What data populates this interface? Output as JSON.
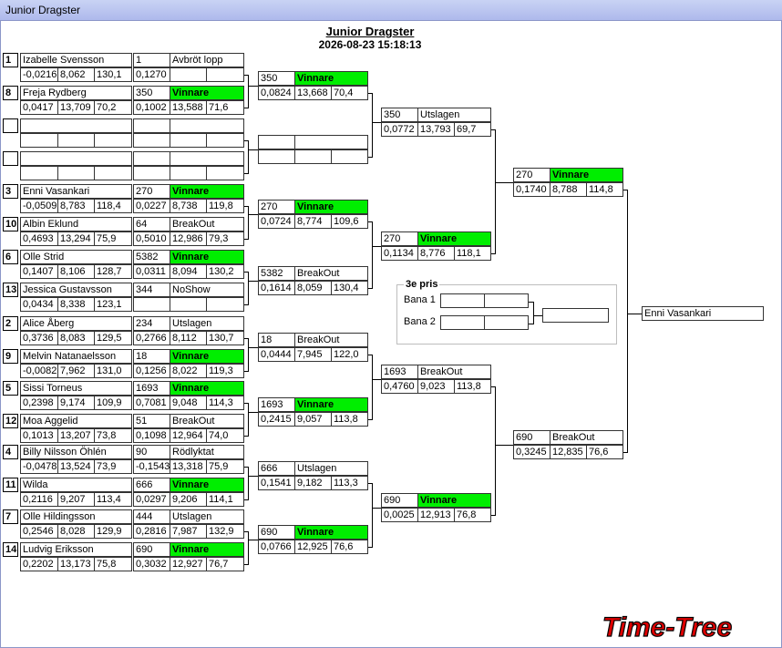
{
  "window": {
    "title": "Junior Dragster"
  },
  "header": {
    "title": "Junior Dragster",
    "datetime": "2026-08-23 15:18:13"
  },
  "colors": {
    "winner": "#00ee00",
    "logo": "#e00000"
  },
  "logo": {
    "text": "Time-Tree"
  },
  "round1": [
    {
      "seed": "1",
      "name": "Izabelle Svensson",
      "rt": "-0,0216",
      "et": "8,062",
      "mph": "130,1",
      "dial": "1",
      "result": "Avbröt lopp",
      "rt2": "0,1270",
      "et2": "",
      "mph2": "",
      "winner": false
    },
    {
      "seed": "8",
      "name": "Freja Rydberg",
      "rt": "0,0417",
      "et": "13,709",
      "mph": "70,2",
      "dial": "350",
      "result": "Vinnare",
      "rt2": "0,1002",
      "et2": "13,588",
      "mph2": "71,6",
      "winner": true
    },
    {
      "seed": "",
      "name": "",
      "rt": "",
      "et": "",
      "mph": "",
      "dial": "",
      "result": "",
      "rt2": "",
      "et2": "",
      "mph2": "",
      "winner": false
    },
    {
      "seed": "",
      "name": "",
      "rt": "",
      "et": "",
      "mph": "",
      "dial": "",
      "result": "",
      "rt2": "",
      "et2": "",
      "mph2": "",
      "winner": false
    },
    {
      "seed": "3",
      "name": "Enni Vasankari",
      "rt": "-0,0509",
      "et": "8,783",
      "mph": "118,4",
      "dial": "270",
      "result": "Vinnare",
      "rt2": "0,0227",
      "et2": "8,738",
      "mph2": "119,8",
      "winner": true
    },
    {
      "seed": "10",
      "name": "Albin Eklund",
      "rt": "0,4693",
      "et": "13,294",
      "mph": "75,9",
      "dial": "64",
      "result": "BreakOut",
      "rt2": "0,5010",
      "et2": "12,986",
      "mph2": "79,3",
      "winner": false
    },
    {
      "seed": "6",
      "name": "Olle Strid",
      "rt": "0,1407",
      "et": "8,106",
      "mph": "128,7",
      "dial": "5382",
      "result": "Vinnare",
      "rt2": "0,0311",
      "et2": "8,094",
      "mph2": "130,2",
      "winner": true
    },
    {
      "seed": "13",
      "name": "Jessica Gustavsson",
      "rt": "0,0434",
      "et": "8,338",
      "mph": "123,1",
      "dial": "344",
      "result": "NoShow",
      "rt2": "",
      "et2": "",
      "mph2": "",
      "winner": false
    },
    {
      "seed": "2",
      "name": "Alice Åberg",
      "rt": "0,3736",
      "et": "8,083",
      "mph": "129,5",
      "dial": "234",
      "result": "Utslagen",
      "rt2": "0,2766",
      "et2": "8,112",
      "mph2": "130,7",
      "winner": false
    },
    {
      "seed": "9",
      "name": "Melvin Natanaelsson",
      "rt": "-0,0082",
      "et": "7,962",
      "mph": "131,0",
      "dial": "18",
      "result": "Vinnare",
      "rt2": "0,1256",
      "et2": "8,022",
      "mph2": "119,3",
      "winner": true
    },
    {
      "seed": "5",
      "name": "Sissi Torneus",
      "rt": "0,2398",
      "et": "9,174",
      "mph": "109,9",
      "dial": "1693",
      "result": "Vinnare",
      "rt2": "0,7081",
      "et2": "9,048",
      "mph2": "114,3",
      "winner": true
    },
    {
      "seed": "12",
      "name": "Moa Aggelid",
      "rt": "0,1013",
      "et": "13,207",
      "mph": "73,8",
      "dial": "51",
      "result": "BreakOut",
      "rt2": "0,1098",
      "et2": "12,964",
      "mph2": "74,0",
      "winner": false
    },
    {
      "seed": "4",
      "name": "Billy Nilsson Öhlén",
      "rt": "-0,0478",
      "et": "13,524",
      "mph": "73,9",
      "dial": "90",
      "result": "Rödlyktat",
      "rt2": "-0,1543",
      "et2": "13,318",
      "mph2": "75,9",
      "winner": false
    },
    {
      "seed": "11",
      "name": "Wilda",
      "rt": "0,2116",
      "et": "9,207",
      "mph": "113,4",
      "dial": "666",
      "result": "Vinnare",
      "rt2": "0,0297",
      "et2": "9,206",
      "mph2": "114,1",
      "winner": true
    },
    {
      "seed": "7",
      "name": "Olle Hildingsson",
      "rt": "0,2546",
      "et": "8,028",
      "mph": "129,9",
      "dial": "444",
      "result": "Utslagen",
      "rt2": "0,2816",
      "et2": "7,987",
      "mph2": "132,9",
      "winner": false
    },
    {
      "seed": "14",
      "name": "Ludvig  Eriksson",
      "rt": "0,2202",
      "et": "13,173",
      "mph": "75,8",
      "dial": "690",
      "result": "Vinnare",
      "rt2": "0,3032",
      "et2": "12,927",
      "mph2": "76,7",
      "winner": true
    }
  ],
  "round2": [
    {
      "dial": "350",
      "result": "Vinnare",
      "rt": "0,0824",
      "et": "13,668",
      "mph": "70,4",
      "winner": true
    },
    {
      "dial": "",
      "result": "",
      "rt": "",
      "et": "",
      "mph": "",
      "winner": false
    },
    {
      "dial": "270",
      "result": "Vinnare",
      "rt": "0,0724",
      "et": "8,774",
      "mph": "109,6",
      "winner": true
    },
    {
      "dial": "5382",
      "result": "BreakOut",
      "rt": "0,1614",
      "et": "8,059",
      "mph": "130,4",
      "winner": false
    },
    {
      "dial": "18",
      "result": "BreakOut",
      "rt": "0,0444",
      "et": "7,945",
      "mph": "122,0",
      "winner": false
    },
    {
      "dial": "1693",
      "result": "Vinnare",
      "rt": "0,2415",
      "et": "9,057",
      "mph": "113,8",
      "winner": true
    },
    {
      "dial": "666",
      "result": "Utslagen",
      "rt": "0,1541",
      "et": "9,182",
      "mph": "113,3",
      "winner": false
    },
    {
      "dial": "690",
      "result": "Vinnare",
      "rt": "0,0766",
      "et": "12,925",
      "mph": "76,6",
      "winner": true
    }
  ],
  "round3": [
    {
      "dial": "350",
      "result": "Utslagen",
      "rt": "0,0772",
      "et": "13,793",
      "mph": "69,7",
      "winner": false
    },
    {
      "dial": "270",
      "result": "Vinnare",
      "rt": "0,1134",
      "et": "8,776",
      "mph": "118,1",
      "winner": true
    },
    {
      "dial": "1693",
      "result": "BreakOut",
      "rt": "0,4760",
      "et": "9,023",
      "mph": "113,8",
      "winner": false
    },
    {
      "dial": "690",
      "result": "Vinnare",
      "rt": "0,0025",
      "et": "12,913",
      "mph": "76,8",
      "winner": true
    }
  ],
  "round4": [
    {
      "dial": "270",
      "result": "Vinnare",
      "rt": "0,1740",
      "et": "8,788",
      "mph": "114,8",
      "winner": true
    },
    {
      "dial": "690",
      "result": "BreakOut",
      "rt": "0,3245",
      "et": "12,835",
      "mph": "76,6",
      "winner": false
    }
  ],
  "final": {
    "winner_name": "Enni Vasankari"
  },
  "third_place": {
    "title": "3e pris",
    "lane1_label": "Bana 1",
    "lane2_label": "Bana 2"
  }
}
